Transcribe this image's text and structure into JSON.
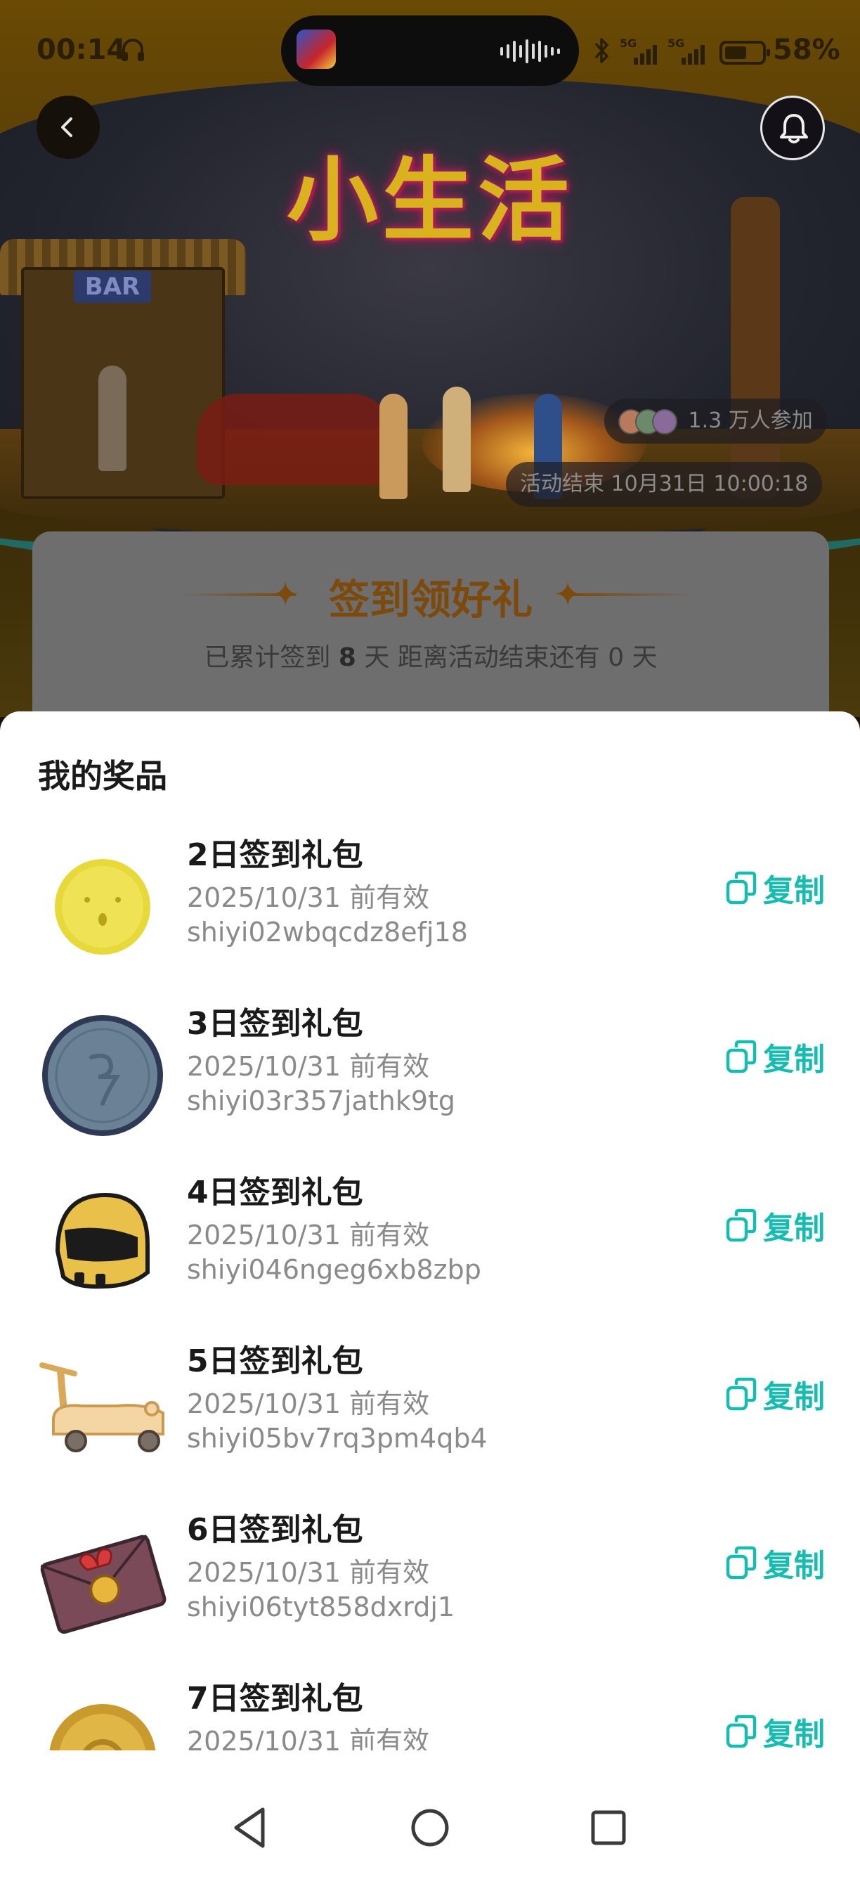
{
  "status_bar": {
    "time": "00:14",
    "network_1": "5G",
    "network_2": "5G",
    "battery_percent": "58%"
  },
  "background": {
    "event_title": "小生活",
    "bar_sign": "BAR",
    "participants": "1.3 万人参加",
    "end_time": "活动结束 10月31日 10:00:18",
    "signin_card": {
      "title": "签到领好礼",
      "subtitle_prefix": "已累计签到",
      "days_count": "8",
      "subtitle_suffix": "天  距离活动结束还有 0 天"
    }
  },
  "sheet": {
    "title": "我的奖品",
    "copy_label": "复制",
    "items": [
      {
        "title": "2日签到礼包",
        "valid": "2025/10/31 前有效",
        "code": "shiyi02wbqcdz8efj18",
        "icon": "yellow-coin-icon"
      },
      {
        "title": "3日签到礼包",
        "valid": "2025/10/31 前有效",
        "code": "shiyi03r357jathk9tg",
        "icon": "blue-token-icon"
      },
      {
        "title": "4日签到礼包",
        "valid": "2025/10/31 前有效",
        "code": "shiyi046ngeg6xb8zbp",
        "icon": "helmet-icon"
      },
      {
        "title": "5日签到礼包",
        "valid": "2025/10/31 前有效",
        "code": "shiyi05bv7rq3pm4qb4",
        "icon": "scooter-icon"
      },
      {
        "title": "6日签到礼包",
        "valid": "2025/10/31 前有效",
        "code": "shiyi06tyt858dxrdj1",
        "icon": "envelope-icon"
      },
      {
        "title": "7日签到礼包",
        "valid": "2025/10/31 前有效",
        "code": "",
        "icon": "gold-coin-icon"
      }
    ]
  },
  "colors": {
    "accent": "#15bcaf",
    "title_text": "#1a1a1a",
    "secondary_text": "#8a8a8a"
  }
}
